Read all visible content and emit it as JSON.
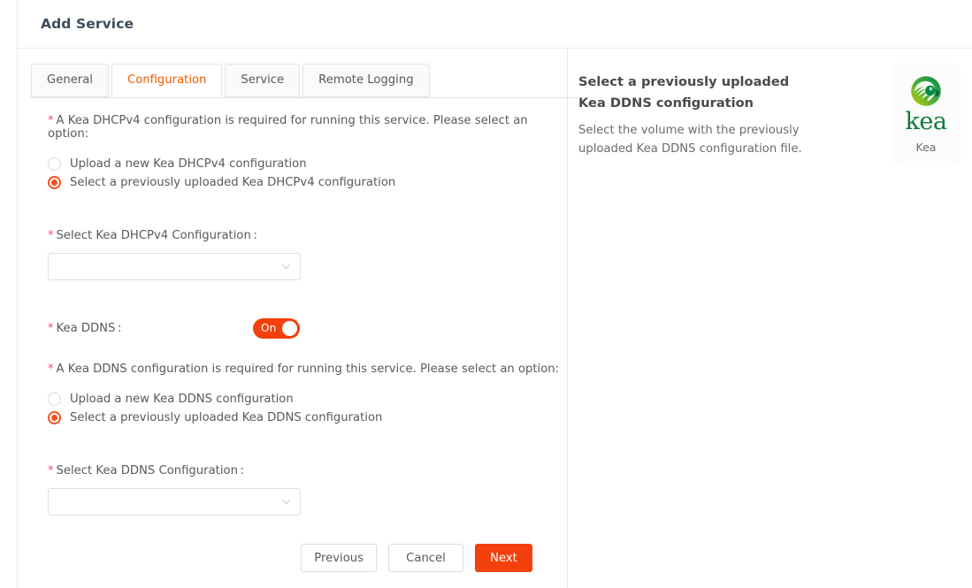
{
  "dialog": {
    "title": "Add Service"
  },
  "tabs": [
    {
      "label": "General",
      "active": false
    },
    {
      "label": "Configuration",
      "active": true
    },
    {
      "label": "Service",
      "active": false
    },
    {
      "label": "Remote Logging",
      "active": false
    }
  ],
  "form": {
    "required_marker": "*",
    "dhcpv4_prompt": "A Kea DHCPv4 configuration is required for running this service. Please select an option:",
    "dhcpv4_options": [
      {
        "label": "Upload a new Kea DHCPv4 configuration",
        "selected": false
      },
      {
        "label": "Select a previously uploaded Kea DHCPv4 configuration",
        "selected": true
      }
    ],
    "dhcpv4_select_label": "Select Kea DHCPv4 Configuration :",
    "dhcpv4_select_value": "",
    "dhcpv4_select_placeholder": "",
    "ddns_toggle_label": "Kea DDNS :",
    "ddns_toggle_state": "On",
    "ddns_prompt": "A Kea DDNS configuration is required for running this service. Please select an option:",
    "ddns_options": [
      {
        "label": "Upload a new Kea DDNS configuration",
        "selected": false
      },
      {
        "label": "Select a previously uploaded Kea DDNS configuration",
        "selected": true
      }
    ],
    "ddns_select_label": "Select Kea DDNS Configuration :",
    "ddns_select_value": "",
    "ddns_select_placeholder": ""
  },
  "buttons": {
    "previous": "Previous",
    "cancel": "Cancel",
    "next": "Next"
  },
  "help_panel": {
    "title": "Select a previously uploaded Kea DDNS configuration",
    "description": "Select the volume with the previously uploaded Kea DDNS configuration file."
  },
  "logo": {
    "wordmark": "kea",
    "caption": "Kea"
  },
  "colors": {
    "accent": "#f4400c",
    "accent_tab": "#f45b00",
    "required": "#e8507f",
    "title": "#3e4b5b",
    "kea_green": "#0d7a3e"
  }
}
